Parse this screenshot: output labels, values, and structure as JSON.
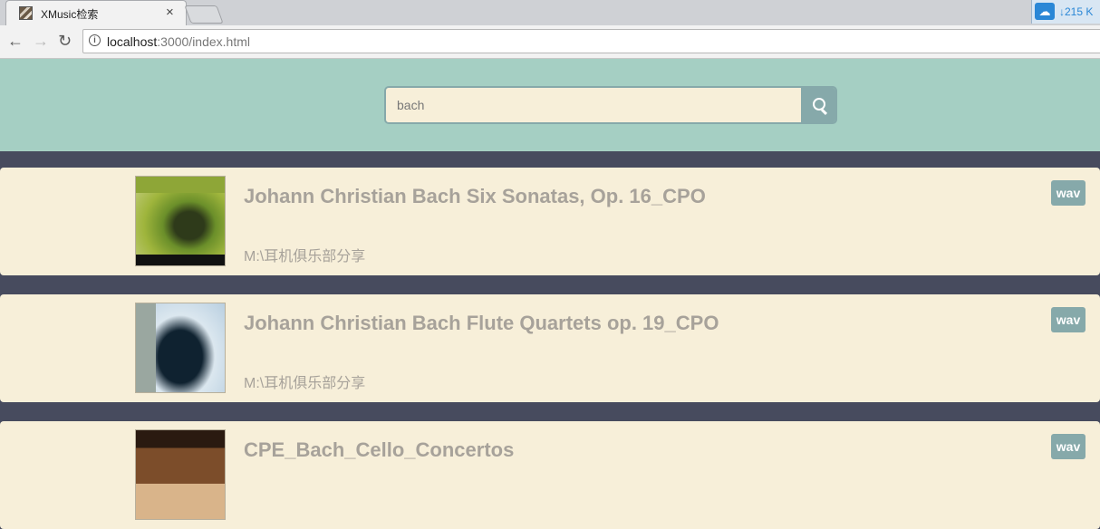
{
  "browser": {
    "tab_title": "XMusic检索",
    "tab_close": "×",
    "extension_text": "↓215 K",
    "url_host": "localhost",
    "url_rest": ":3000/index.html"
  },
  "search": {
    "value": "bach"
  },
  "results": [
    {
      "title": "Johann Christian Bach Six Sonatas, Op. 16_CPO",
      "path": "M:\\耳机俱乐部分享",
      "format": "wav"
    },
    {
      "title": "Johann Christian Bach Flute Quartets op. 19_CPO",
      "path": "M:\\耳机俱乐部分享",
      "format": "wav"
    },
    {
      "title": "CPE_Bach_Cello_Concertos",
      "path": "",
      "format": "wav"
    }
  ],
  "colors": {
    "header_bg": "#a5cfc3",
    "page_bg": "#474b5e",
    "card_bg": "#f7efd9",
    "accent": "#86a9aa",
    "text_muted": "#a7a29a"
  }
}
